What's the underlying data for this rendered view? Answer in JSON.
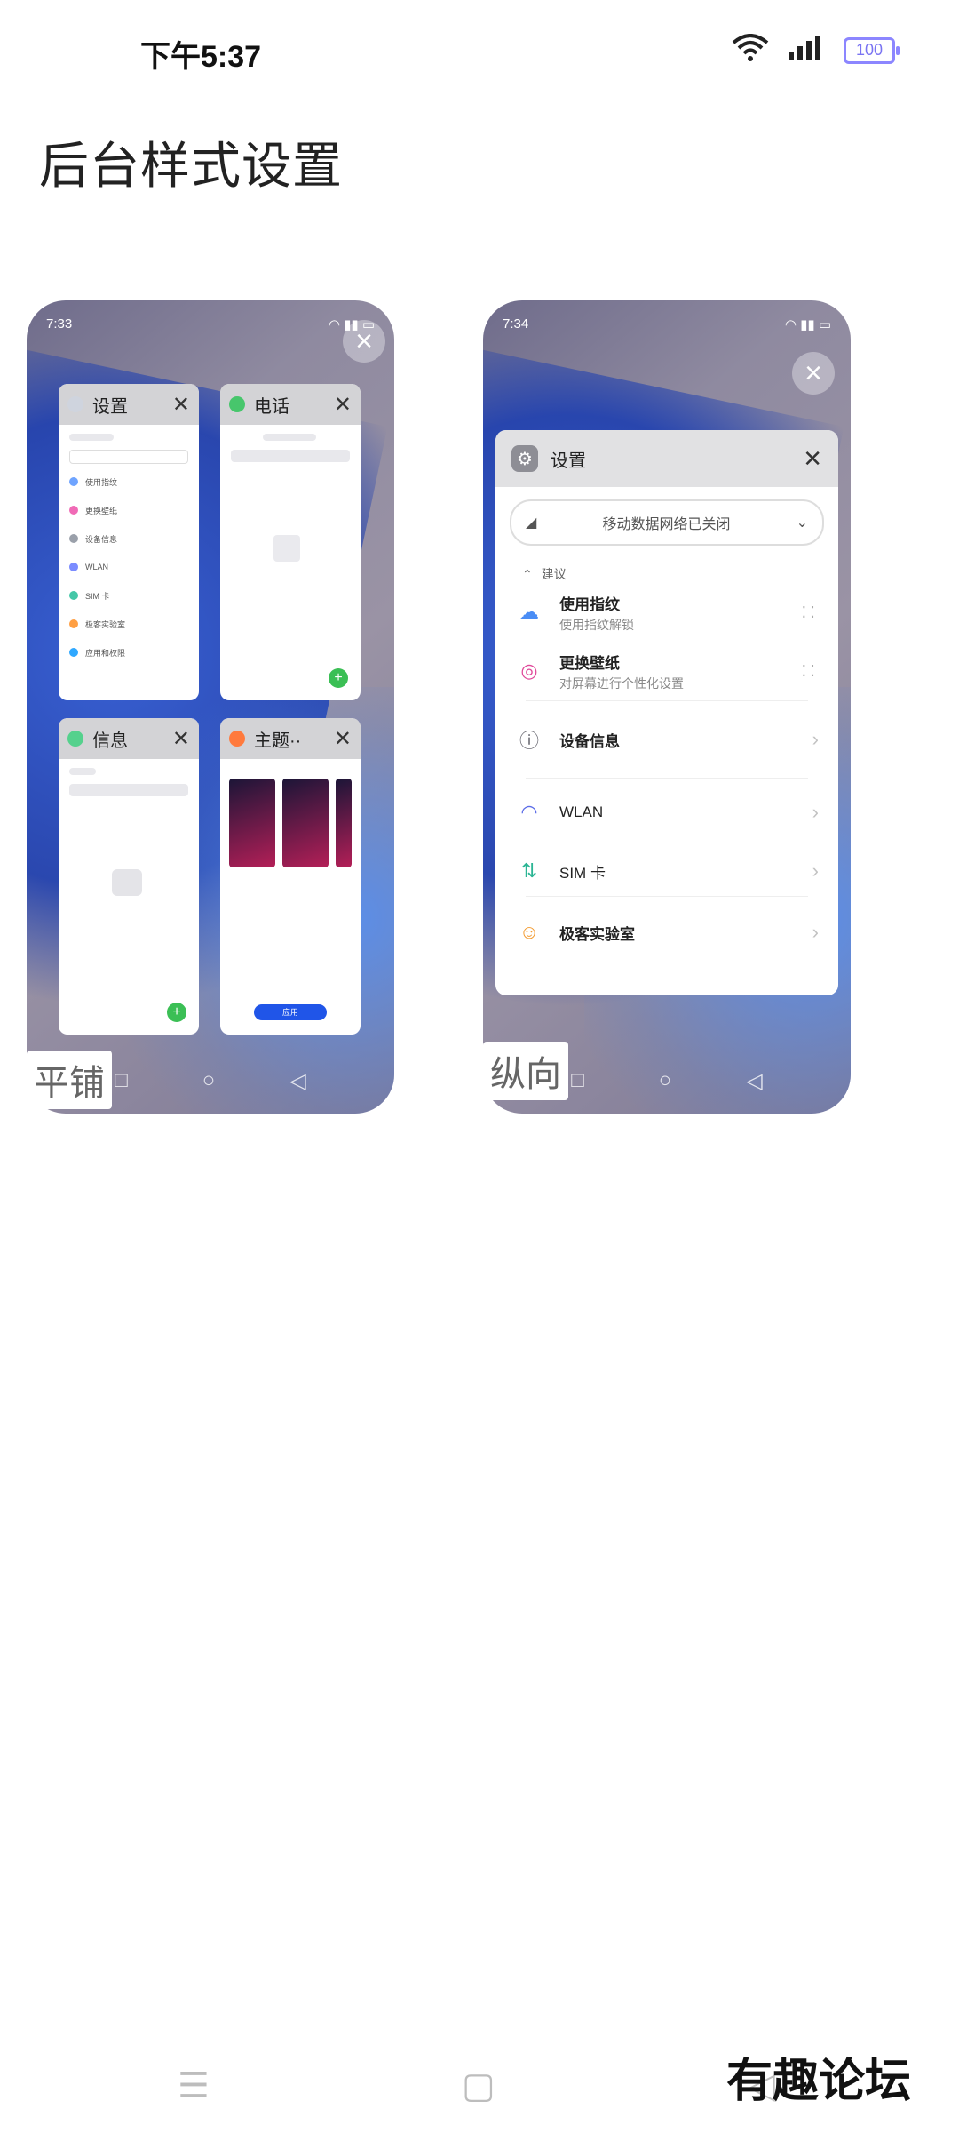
{
  "status_bar": {
    "time": "下午5:37",
    "battery": "100"
  },
  "page": {
    "title": "后台样式设置"
  },
  "option_tile": {
    "label": "平铺",
    "preview_time": "7:33",
    "cards": [
      {
        "title": "设置",
        "color": "#6fa4ff"
      },
      {
        "title": "电话",
        "color": "#47c66c"
      },
      {
        "title": "信息",
        "color": "#55d18d"
      },
      {
        "title": "主题··",
        "color": "#ff7a3d"
      }
    ],
    "apply_label": "应用"
  },
  "option_vertical": {
    "label": "纵向",
    "preview_time": "7:34",
    "card": {
      "title": "设置",
      "mobile_data": "移动数据网络已关闭",
      "section": "建议",
      "items": [
        {
          "title": "使用指纹",
          "sub": "使用指纹解锁"
        },
        {
          "title": "更换壁纸",
          "sub": "对屏幕进行个性化设置"
        },
        {
          "title": "设备信息",
          "sub": ""
        },
        {
          "title": "WLAN",
          "sub": ""
        },
        {
          "title": "SIM 卡",
          "sub": ""
        },
        {
          "title": "极客实验室",
          "sub": ""
        }
      ]
    }
  },
  "watermark": "有趣论坛"
}
